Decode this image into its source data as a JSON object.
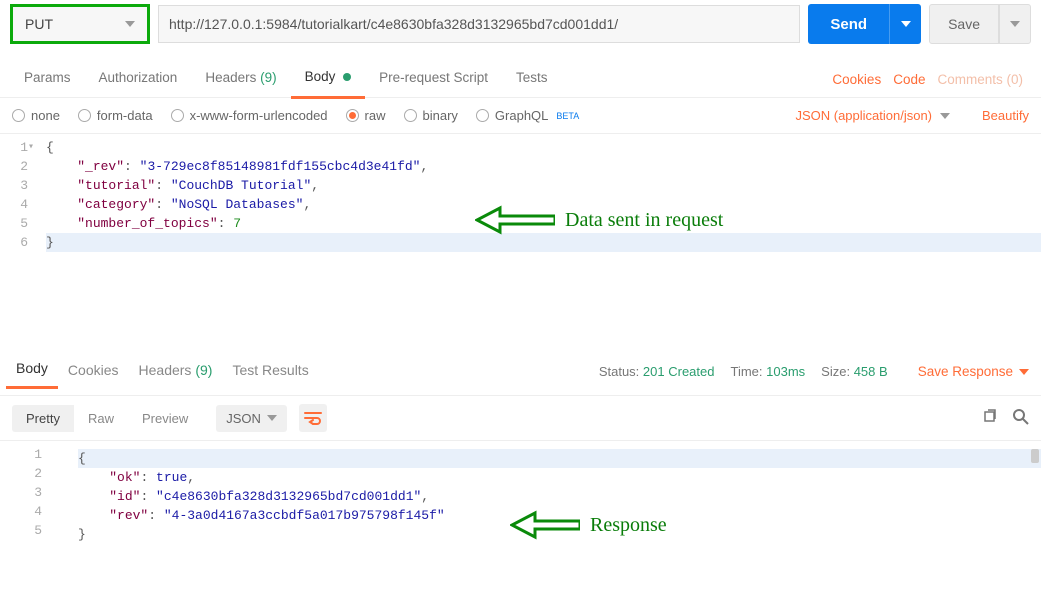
{
  "request": {
    "method": "PUT",
    "url": "http://127.0.0.1:5984/tutorialkart/c4e8630bfa328d3132965bd7cd001dd1/",
    "send_label": "Send",
    "save_label": "Save"
  },
  "tabs": {
    "params": "Params",
    "authorization": "Authorization",
    "headers": "Headers",
    "headers_count": "(9)",
    "body": "Body",
    "prerequest": "Pre-request Script",
    "tests": "Tests",
    "cookies": "Cookies",
    "code": "Code",
    "comments": "Comments (0)"
  },
  "body_types": {
    "none": "none",
    "form_data": "form-data",
    "x_www": "x-www-form-urlencoded",
    "raw": "raw",
    "binary": "binary",
    "graphql": "GraphQL",
    "beta": "BETA",
    "content_type": "JSON (application/json)",
    "beautify": "Beautify"
  },
  "request_body": {
    "lines": [
      "1",
      "2",
      "3",
      "4",
      "5",
      "6"
    ],
    "l1_open": "{",
    "l2_key": "\"_rev\"",
    "l2_val": "\"3-729ec8f85148981fdf155cbc4d3e41fd\"",
    "l3_key": "\"tutorial\"",
    "l3_val": "\"CouchDB Tutorial\"",
    "l4_key": "\"category\"",
    "l4_val": "\"NoSQL Databases\"",
    "l5_key": "\"number_of_topics\"",
    "l5_val": "7",
    "l6_close": "}"
  },
  "response": {
    "tabs": {
      "body": "Body",
      "cookies": "Cookies",
      "headers": "Headers",
      "headers_count": "(9)",
      "test_results": "Test Results"
    },
    "status_label": "Status:",
    "status_val": "201 Created",
    "time_label": "Time:",
    "time_val": "103ms",
    "size_label": "Size:",
    "size_val": "458 B",
    "save_response": "Save Response",
    "toolbar": {
      "pretty": "Pretty",
      "raw": "Raw",
      "preview": "Preview",
      "json": "JSON"
    },
    "lines": [
      "1",
      "2",
      "3",
      "4",
      "5"
    ],
    "l1": "{",
    "l2_key": "\"ok\"",
    "l2_val": "true",
    "l3_key": "\"id\"",
    "l3_val": "\"c4e8630bfa328d3132965bd7cd001dd1\"",
    "l4_key": "\"rev\"",
    "l4_val": "\"4-3a0d4167a3ccbdf5a017b975798f145f\"",
    "l5": "}"
  },
  "annotations": {
    "req": "Data sent in request",
    "resp": "Response"
  }
}
